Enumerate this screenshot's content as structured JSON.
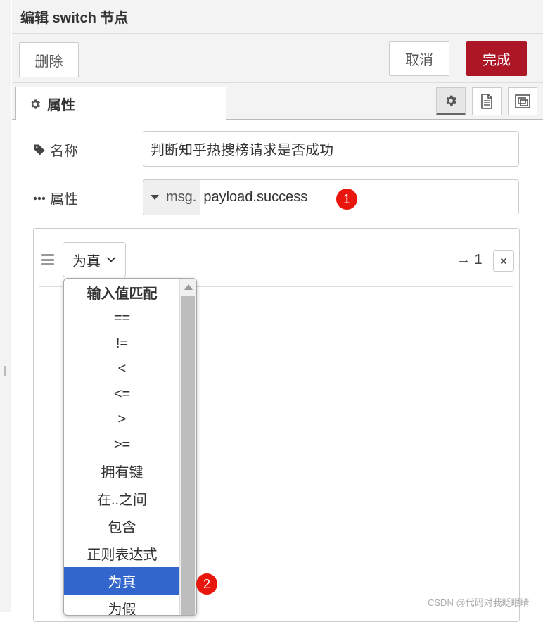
{
  "header": {
    "title": "编辑 switch 节点"
  },
  "toolbar": {
    "delete_label": "删除",
    "cancel_label": "取消",
    "done_label": "完成",
    "done_color": "#ad1625"
  },
  "tabs": {
    "properties_label": "属性"
  },
  "form": {
    "name_label": "名称",
    "name_value": "判断知乎热搜榜请求是否成功",
    "property_label": "属性",
    "property_type": "msg.",
    "property_value": "payload.success"
  },
  "markers": {
    "first": "1",
    "second": "2"
  },
  "rule": {
    "selected_operator": "为真",
    "output": "→ 1"
  },
  "dropdown": {
    "header": "输入值匹配",
    "items": [
      "==",
      "!=",
      "<",
      "<=",
      ">",
      ">=",
      "拥有键",
      "在..之间",
      "包含",
      "正则表达式",
      "为真",
      "为假"
    ],
    "selected": "为真",
    "selected_color": "#3366cc"
  },
  "watermark": "CSDN @代码对我眨眼睛"
}
